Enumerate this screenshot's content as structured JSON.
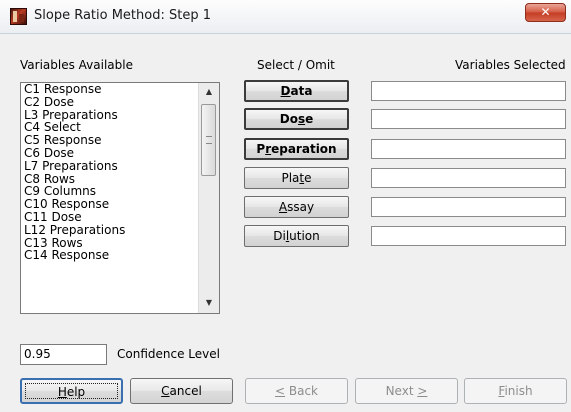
{
  "window": {
    "title": "Slope Ratio Method: Step 1",
    "close_label": "✕"
  },
  "headers": {
    "variables_available": "Variables Available",
    "select_omit": "Select / Omit",
    "variables_selected": "Variables Selected"
  },
  "variables": [
    "C1 Response",
    "C2 Dose",
    "L3 Preparations",
    "C4 Select",
    "C5 Response",
    "C6 Dose",
    "L7 Preparations",
    "C8 Rows",
    "C9 Columns",
    "C10 Response",
    "C11 Dose",
    "L12 Preparations",
    "C13 Rows",
    "C14 Response"
  ],
  "select_buttons": [
    {
      "label_pre": "",
      "label_u": "D",
      "label_post": "ata",
      "bold": true
    },
    {
      "label_pre": "Do",
      "label_u": "s",
      "label_post": "e",
      "bold": true
    },
    {
      "label_pre": "P",
      "label_u": "r",
      "label_post": "eparation",
      "bold": true
    },
    {
      "label_pre": "Pla",
      "label_u": "t",
      "label_post": "e",
      "bold": false
    },
    {
      "label_pre": "",
      "label_u": "A",
      "label_post": "ssay",
      "bold": false
    },
    {
      "label_pre": "Di",
      "label_u": "l",
      "label_post": "ution",
      "bold": false
    }
  ],
  "selected_values": [
    "",
    "",
    "",
    "",
    "",
    ""
  ],
  "confidence": {
    "value": "0.95",
    "label": "Confidence Level"
  },
  "buttons": {
    "help": {
      "u": "H",
      "rest": "elp"
    },
    "cancel": {
      "u": "C",
      "rest": "ancel"
    },
    "back": {
      "pre": "",
      "u": "<",
      "rest": " Back"
    },
    "next": {
      "pre": "Next ",
      "u": ">",
      "rest": ""
    },
    "finish": {
      "u": "F",
      "rest": "inish"
    }
  }
}
